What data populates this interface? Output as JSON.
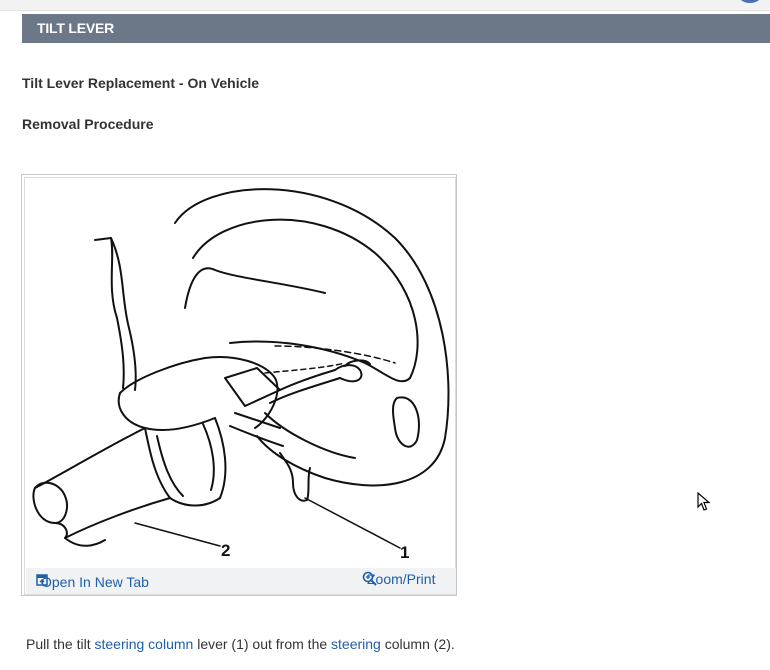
{
  "header": {
    "title": "TILT LEVER"
  },
  "article": {
    "subtitle": "Tilt Lever Replacement - On Vehicle",
    "procedure_heading": "Removal Procedure"
  },
  "figure": {
    "callouts": [
      "2",
      "1"
    ],
    "toolbar": {
      "open_tab_label": "Open In New Tab",
      "zoom_print_label": "Zoom/Print"
    }
  },
  "instruction": {
    "part1": "Pull the tilt ",
    "link1": "steering column",
    "part2": " lever (1) out from the ",
    "link2": "steering",
    "part3": " column (2)."
  },
  "icons": {
    "open_tab": "open-new-tab-icon",
    "zoom": "magnifier-plus-icon",
    "cursor": "mouse-pointer-icon"
  },
  "colors": {
    "header_bg": "#6c7787",
    "link": "#1f5fa8",
    "text": "#333333"
  }
}
